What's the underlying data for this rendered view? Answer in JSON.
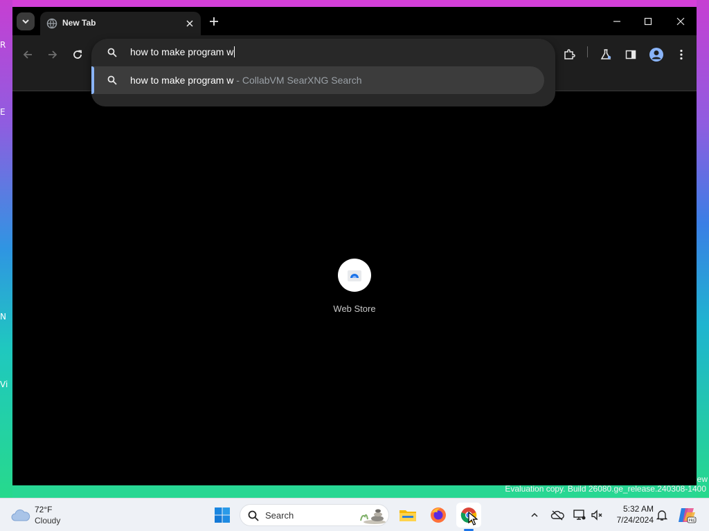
{
  "desktop": {
    "left_fragments": [
      "R",
      "E",
      "N",
      "Vi"
    ],
    "watermark_fragment": "ew",
    "watermark": "Evaluation copy. Build 26080.ge_release.240308-1400"
  },
  "browser": {
    "tab": {
      "title": "New Tab"
    },
    "omnibox": {
      "input_value": "how to make program w",
      "suggestion": {
        "text": "how to make program w",
        "separator": " - ",
        "source": "CollabVM SearXNG Search"
      }
    },
    "ntp": {
      "shortcuts": [
        {
          "label": "Web Store"
        }
      ]
    }
  },
  "taskbar": {
    "weather": {
      "temp": "72°F",
      "condition": "Cloudy"
    },
    "search_placeholder": "Search",
    "clock": {
      "time": "5:32 AM",
      "date": "7/24/2024"
    }
  },
  "colors": {
    "accent": "#8ab4f8",
    "chrome_dark": "#1e1e1e",
    "taskbar_bg": "#eef1f6"
  }
}
